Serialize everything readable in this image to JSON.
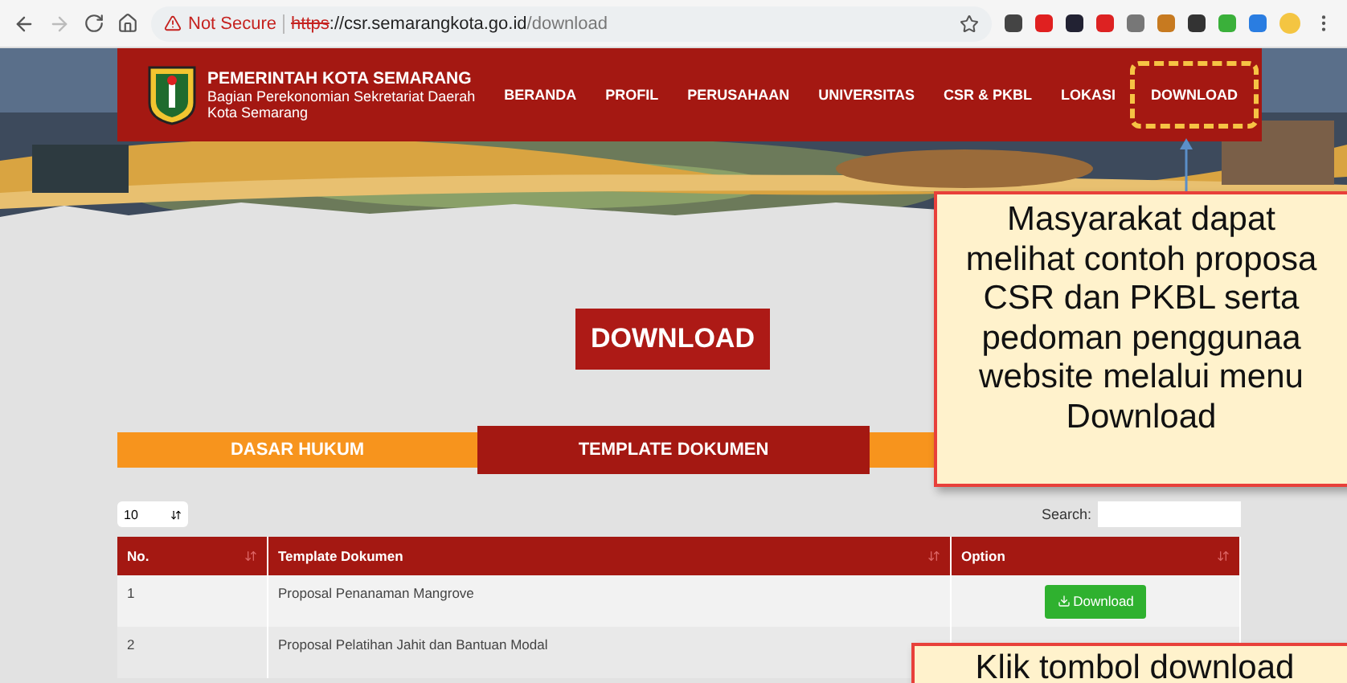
{
  "browser": {
    "security": "Not Secure",
    "url_scheme": "https",
    "url_host": "://csr.semarangkota.go.id",
    "url_path": "/download"
  },
  "site": {
    "title": "PEMERINTAH KOTA SEMARANG",
    "subtitle_lines": [
      "Bagian Perekonomian Sekretariat Daerah",
      "Kota Semarang"
    ]
  },
  "nav": [
    {
      "label": "BERANDA",
      "highlighted": false
    },
    {
      "label": "PROFIL",
      "highlighted": false
    },
    {
      "label": "PERUSAHAAN",
      "highlighted": false
    },
    {
      "label": "UNIVERSITAS",
      "highlighted": false
    },
    {
      "label": "CSR & PKBL",
      "highlighted": false
    },
    {
      "label": "LOKASI",
      "highlighted": false
    },
    {
      "label": "DOWNLOAD",
      "highlighted": true
    }
  ],
  "heading": "DOWNLOAD",
  "tabs": [
    {
      "label": "DASAR HUKUM",
      "selected": false
    },
    {
      "label": "TEMPLATE DOKUMEN",
      "selected": true
    },
    {
      "selected": false
    }
  ],
  "table": {
    "page_size": "10",
    "search_label": "Search:",
    "columns": [
      "No.",
      "Template Dokumen",
      "Option"
    ],
    "rows": [
      {
        "no": "1",
        "name": "Proposal Penanaman Mangrove",
        "button": "Download"
      },
      {
        "no": "2",
        "name": "Proposal Pelatihan Jahit dan Bantuan Modal"
      }
    ]
  },
  "callouts": [
    {
      "lines": [
        "Masyarakat dapat",
        "melihat contoh proposa",
        "CSR dan PKBL serta",
        "pedoman penggunaa",
        "website melalui menu",
        "Download"
      ]
    },
    {
      "lines": [
        "Klik tombol download"
      ]
    }
  ]
}
